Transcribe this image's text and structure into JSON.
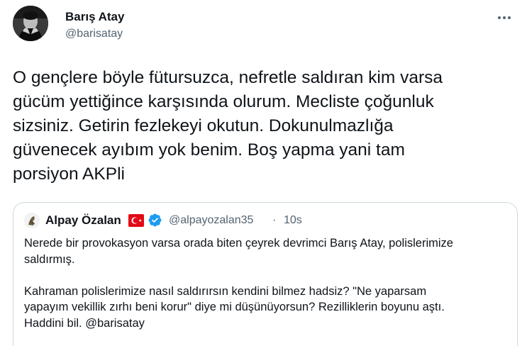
{
  "tweet": {
    "author_name": "Barış Atay",
    "author_handle": "@barisatay",
    "text": "O gençlere böyle fütursuzca, nefretle saldıran kim varsa\ngücüm yettiğince karşısında olurum. Mecliste çoğunluk\nsizsiniz. Getirin fezlekeyi okutun. Dokunulmazlığa\ngüvenecek ayıbım yok benim. Boş yapma yani tam\nporsiyon AKPli",
    "more_icon": "more-horizontal-icon"
  },
  "quoted_tweet": {
    "author_name": "Alpay Özalan",
    "flag_icon": "turkey-flag-icon",
    "verified_icon": "verified-badge-icon",
    "author_handle": "@alpayozalan35",
    "separator": "·",
    "time": "10s",
    "text": "Nerede bir provokasyon varsa orada biten çeyrek devrimci Barış Atay, polislerimize\nsaldırmış.\n\nKahraman polislerimize nasıl saldırırsın kendini bilmez hadsiz? \"Ne yaparsam\nyapayım vekillik zırhı beni korur\" diye mi düşünüyorsun? Rezilliklerin boyunu aştı.\nHaddini bil. @barisatay"
  },
  "colors": {
    "text_primary": "#0f1419",
    "text_secondary": "#536471",
    "border": "#cfd9de",
    "verified_blue": "#1d9bf0",
    "flag_red": "#e30a17"
  }
}
